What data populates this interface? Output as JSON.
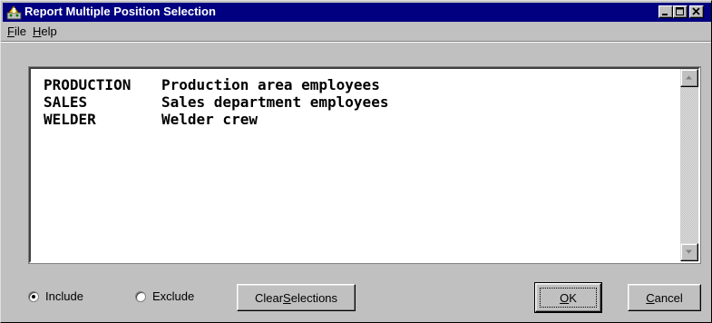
{
  "window": {
    "title": "Report Multiple Position Selection",
    "title_bar_color": "#000080",
    "icon": "app-icon"
  },
  "menu": {
    "file": {
      "mnemonic": "F",
      "rest": "ile"
    },
    "help": {
      "mnemonic": "H",
      "rest": "elp"
    }
  },
  "positions": [
    {
      "code": "PRODUCTION",
      "description": "Production area employees"
    },
    {
      "code": "SALES",
      "description": "Sales department employees"
    },
    {
      "code": "WELDER",
      "description": "Welder crew"
    }
  ],
  "filter_mode": {
    "include_label": "Include",
    "exclude_label": "Exclude",
    "selected": "include"
  },
  "buttons": {
    "clear": {
      "before": "Clear ",
      "mnemonic": "S",
      "after": "elections"
    },
    "ok": {
      "mnemonic": "O",
      "after": "K"
    },
    "cancel": {
      "mnemonic": "C",
      "after": "ancel"
    }
  }
}
